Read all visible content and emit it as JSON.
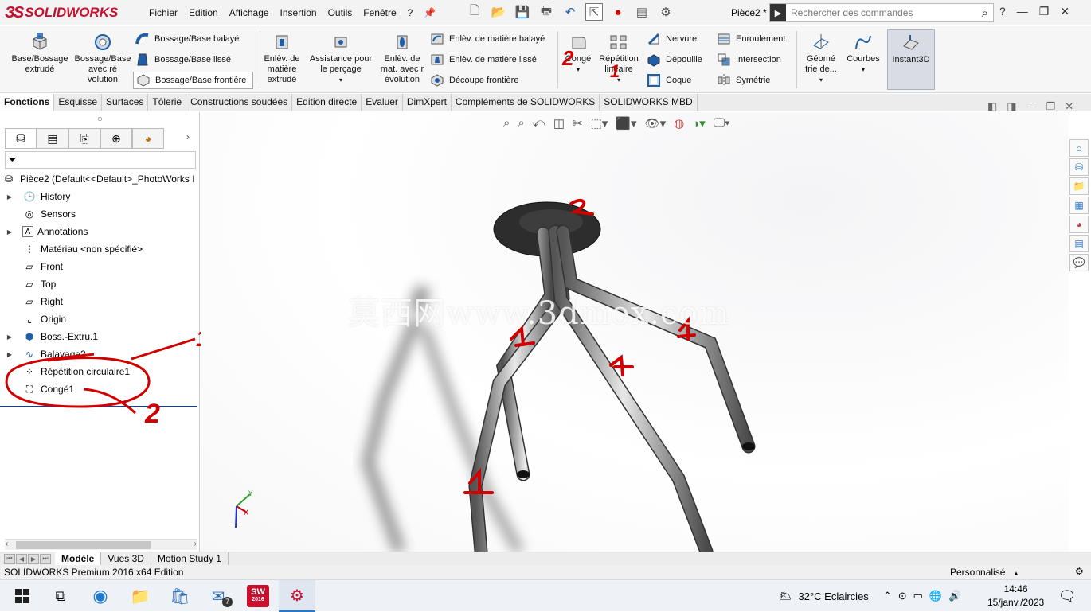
{
  "app": {
    "brand": "SOLIDWORKS",
    "menu": [
      "Fichier",
      "Edition",
      "Affichage",
      "Insertion",
      "Outils",
      "Fenêtre",
      "?"
    ],
    "document": "Pièce2 *",
    "search_placeholder": "Rechercher des commandes",
    "help": "?"
  },
  "ribbon": {
    "base_bossage": "Base/Bossage extrudé",
    "bossage_revolution": "Bossage/Base avec ré volution",
    "bossage_balaye": "Bossage/Base balayé",
    "bossage_lisse": "Bossage/Base lissé",
    "bossage_frontiere": "Bossage/Base frontière",
    "enlev_extrude": "Enlèv. de matière extrudé",
    "assistance_percage": "Assistance pour le perçage",
    "enlev_revolution": "Enlèv. de mat. avec r évolution",
    "enlev_balaye": "Enlèv. de matière balayé",
    "enlev_lisse": "Enlèv. de matière lissé",
    "decoupe_frontiere": "Découpe frontière",
    "conge": "Congé",
    "repetition_lineaire": "Répétition linéaire",
    "nervure": "Nervure",
    "depouille": "Dépouille",
    "coque": "Coque",
    "enroulement": "Enroulement",
    "intersection": "Intersection",
    "symetrie": "Symétrie",
    "geometrie": "Géomé trie de...",
    "courbes": "Courbes",
    "instant3d": "Instant3D"
  },
  "tabs": [
    {
      "label": "Fonctions",
      "active": true
    },
    {
      "label": "Esquisse",
      "active": false
    },
    {
      "label": "Surfaces",
      "active": false
    },
    {
      "label": "Tôlerie",
      "active": false
    },
    {
      "label": "Constructions soudées",
      "active": false
    },
    {
      "label": "Edition directe",
      "active": false
    },
    {
      "label": "Evaluer",
      "active": false
    },
    {
      "label": "DimXpert",
      "active": false
    },
    {
      "label": "Compléments de SOLIDWORKS",
      "active": false
    },
    {
      "label": "SOLIDWORKS MBD",
      "active": false
    }
  ],
  "tree": {
    "root": "Pièce2  (Default<<Default>_PhotoWorks I",
    "items": [
      {
        "label": "History",
        "icon": "history-icon",
        "expandable": true
      },
      {
        "label": "Sensors",
        "icon": "sensors-icon",
        "expandable": false
      },
      {
        "label": "Annotations",
        "icon": "annotations-icon",
        "expandable": true
      },
      {
        "label": "Matériau <non spécifié>",
        "icon": "material-icon",
        "expandable": false
      },
      {
        "label": "Front",
        "icon": "plane-icon",
        "expandable": false
      },
      {
        "label": "Top",
        "icon": "plane-icon",
        "expandable": false
      },
      {
        "label": "Right",
        "icon": "plane-icon",
        "expandable": false
      },
      {
        "label": "Origin",
        "icon": "origin-icon",
        "expandable": false
      },
      {
        "label": "Boss.-Extru.1",
        "icon": "extrude-icon",
        "expandable": true
      },
      {
        "label": "Balayage2",
        "icon": "sweep-icon",
        "expandable": true
      },
      {
        "label": "Répétition circulaire1",
        "icon": "circular-pattern-icon",
        "expandable": false
      },
      {
        "label": "Congé1",
        "icon": "fillet-icon",
        "expandable": false
      }
    ]
  },
  "annotations": {
    "one": "1",
    "two": "2"
  },
  "watermark": "莫西网www.3dmox.com",
  "bottom_tabs": [
    {
      "label": "Modèle",
      "active": true
    },
    {
      "label": "Vues 3D",
      "active": false
    },
    {
      "label": "Motion Study 1",
      "active": false
    }
  ],
  "status": {
    "edition": "SOLIDWORKS Premium 2016 x64 Edition",
    "units": "Personnalisé"
  },
  "taskbar": {
    "weather": "32°C  Eclaircies",
    "time": "14:46",
    "date": "15/janv./2023",
    "mail_badge": "7",
    "sw_badge": "2016"
  },
  "colors": {
    "brand": "#c8102e",
    "annotation": "#d10000"
  }
}
